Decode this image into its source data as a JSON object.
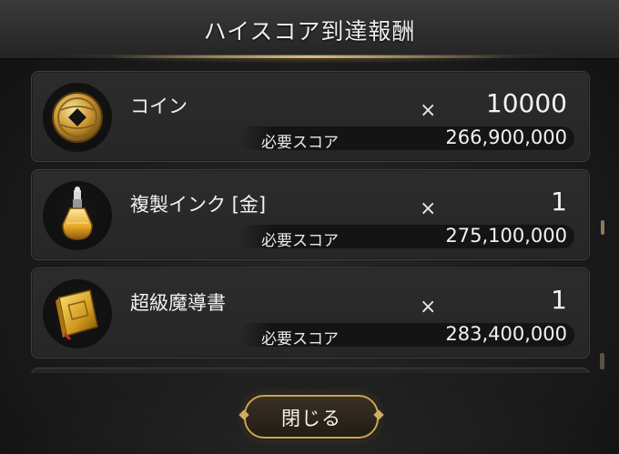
{
  "dialog": {
    "title": "ハイスコア到達報酬",
    "close_label": "閉じる"
  },
  "rewards": [
    {
      "name": "コイン",
      "times": "×",
      "quantity": "10000",
      "score_label": "必要スコア",
      "score": "266,900,000",
      "icon": "coin-icon"
    },
    {
      "name": "複製インク [金]",
      "times": "×",
      "quantity": "1",
      "score_label": "必要スコア",
      "score": "275,100,000",
      "icon": "ink-bottle-icon"
    },
    {
      "name": "超級魔導書",
      "times": "×",
      "quantity": "1",
      "score_label": "必要スコア",
      "score": "283,400,000",
      "icon": "grimoire-icon"
    }
  ],
  "colors": {
    "gold": "#c9a45a",
    "panel": "#2c2c2c",
    "background": "#1b1b1b"
  }
}
